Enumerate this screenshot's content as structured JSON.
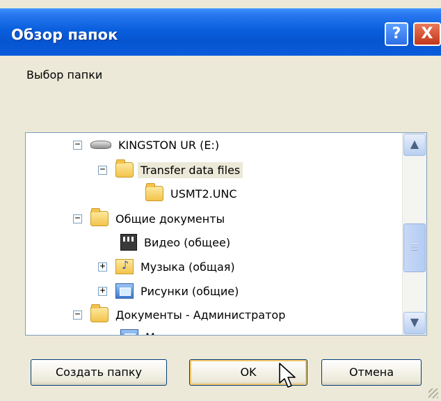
{
  "window": {
    "title": "Обзор папок",
    "help_label": "?",
    "close_label": "X"
  },
  "prompt": "Выбор папки",
  "tree": {
    "items": [
      {
        "label": "KINGSTON UR (E:)",
        "expander": "−",
        "icon": "drive-icon"
      },
      {
        "label": "Transfer data files",
        "expander": "−",
        "icon": "folder-open-icon",
        "selected": true
      },
      {
        "label": "USMT2.UNC",
        "expander": "",
        "icon": "folder-icon"
      },
      {
        "label": "Общие документы",
        "expander": "−",
        "icon": "folder-open-icon"
      },
      {
        "label": "Видео (общее)",
        "expander": "",
        "icon": "video-folder-icon"
      },
      {
        "label": "Музыка (общая)",
        "expander": "+",
        "icon": "music-folder-icon"
      },
      {
        "label": "Рисунки (общие)",
        "expander": "+",
        "icon": "pictures-folder-icon"
      },
      {
        "label": "Документы - Администратор",
        "expander": "−",
        "icon": "folder-open-icon"
      },
      {
        "label": "Мои рисунки",
        "expander": "",
        "icon": "pictures-folder-icon"
      }
    ]
  },
  "buttons": {
    "new_folder": "Создать папку",
    "ok": "OK",
    "cancel": "Отмена"
  },
  "colors": {
    "titlebar": "#0a5fdd",
    "dialog_bg": "#ece9d8",
    "tree_border": "#7f9db9"
  }
}
